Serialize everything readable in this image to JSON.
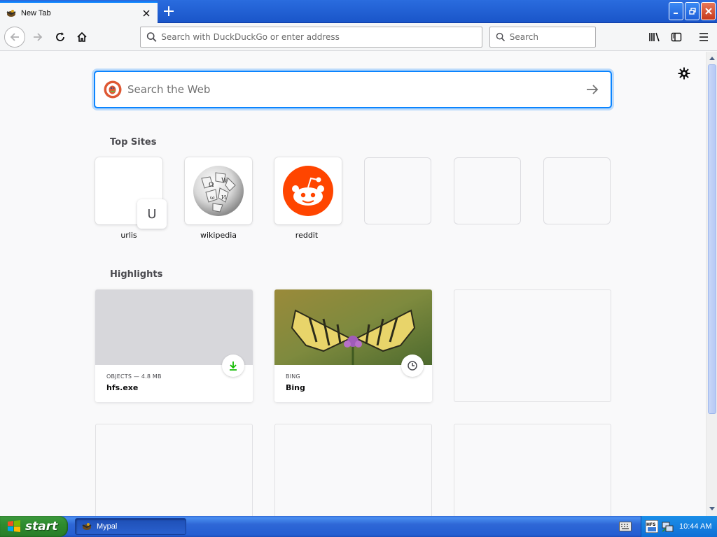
{
  "browser": {
    "tab": {
      "title": "New Tab"
    },
    "toolbar": {
      "url_placeholder": "Search with DuckDuckGo or enter address",
      "search_placeholder": "Search"
    }
  },
  "newtab": {
    "search_placeholder": "Search the Web",
    "top_sites_title": "Top Sites",
    "top_sites": [
      {
        "label": "urlis",
        "letter": "U"
      },
      {
        "label": "wikipedia"
      },
      {
        "label": "reddit"
      }
    ],
    "highlights_title": "Highlights",
    "highlights": [
      {
        "meta": "OBJECTS — 4.8 MB",
        "title": "hfs.exe",
        "type": "download"
      },
      {
        "meta": "BING",
        "title": "Bing",
        "type": "history"
      }
    ]
  },
  "taskbar": {
    "start_label": "start",
    "items": [
      {
        "label": "Mypal"
      }
    ],
    "clock": "10:44 AM",
    "tray_badge": "HFS"
  },
  "colors": {
    "accent": "#0a84ff",
    "reddit": "#ff4500",
    "download_green": "#2ac3a2",
    "taskbar_blue": "#245ed2",
    "start_green": "#2e8b2e"
  }
}
